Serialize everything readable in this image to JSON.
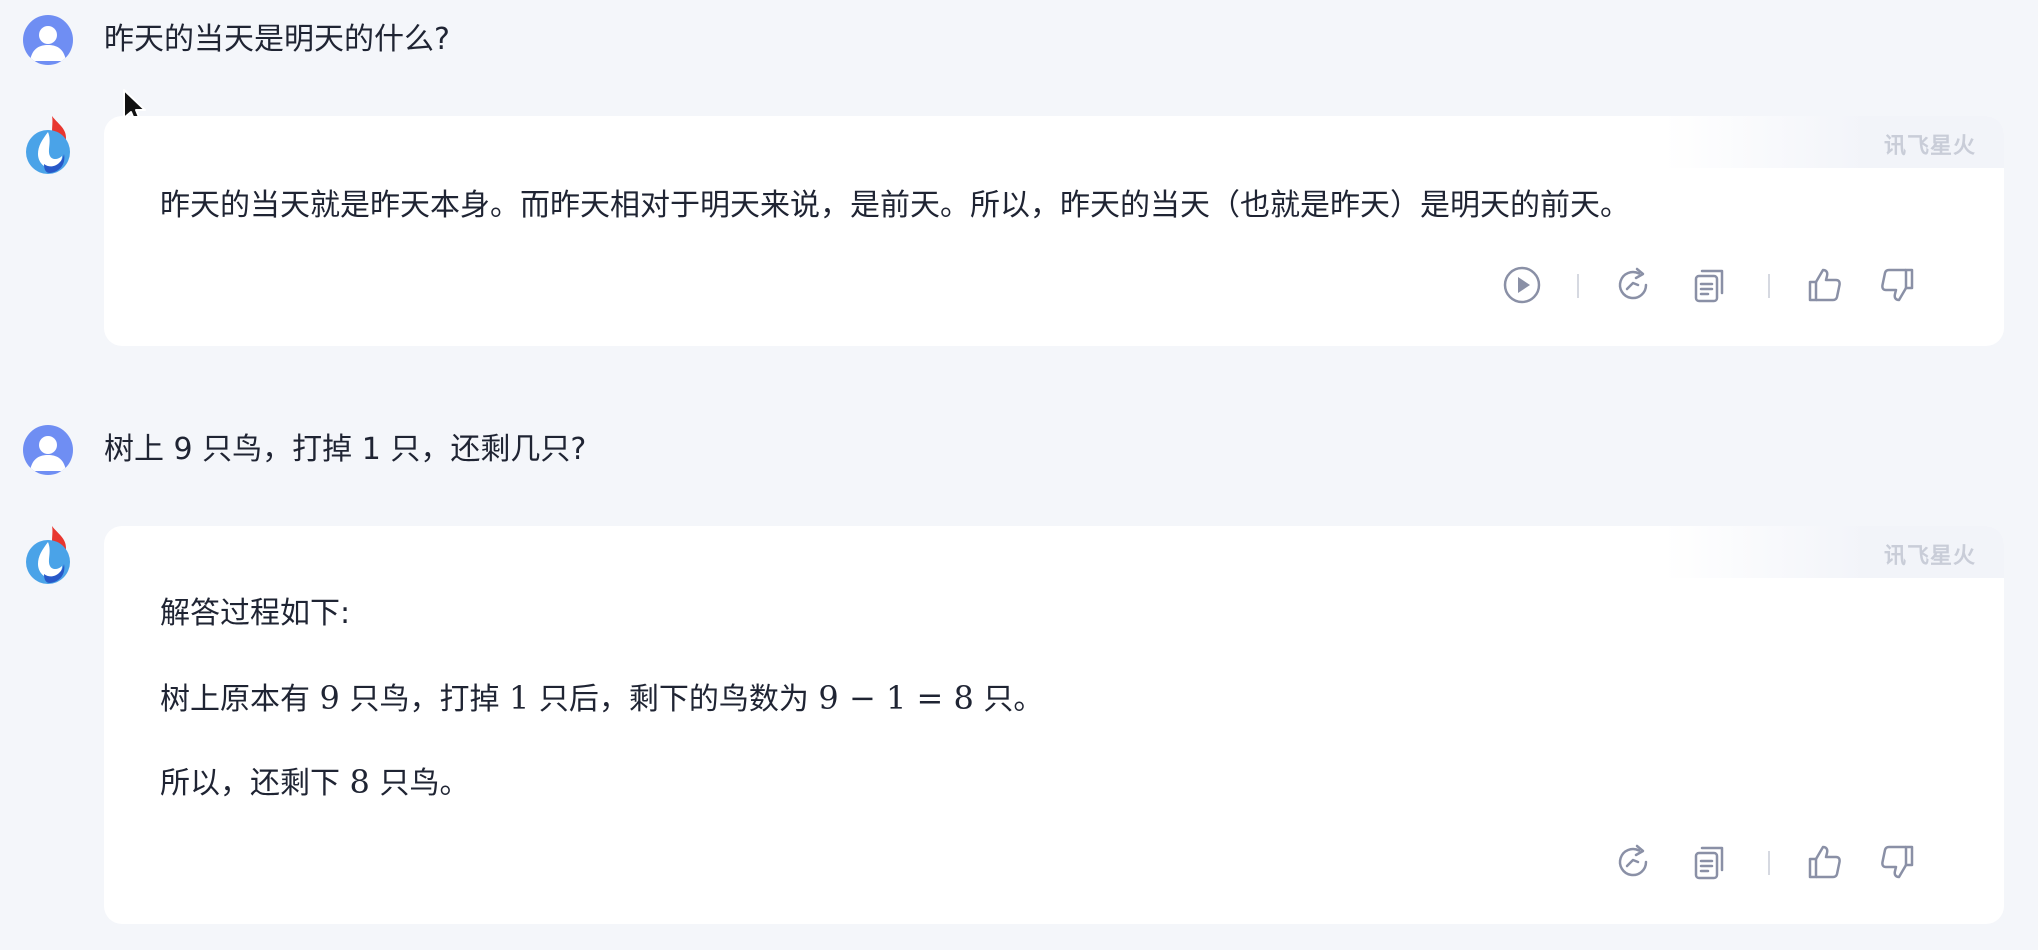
{
  "conversation": {
    "q1": "昨天的当天是明天的什么?",
    "a1": {
      "watermark": "讯飞星火",
      "text": "昨天的当天就是昨天本身。而昨天相对于明天来说，是前天。所以，昨天的当天（也就是昨天）是明天的前天。"
    },
    "q2": "树上 9 只鸟，打掉 1 只，还剩几只?",
    "a2": {
      "watermark": "讯飞星火",
      "line1": "解答过程如下:",
      "line2_pre": "树上原本有 ",
      "line2_n1": "9",
      "line2_mid1": " 只鸟，打掉 ",
      "line2_n2": "1",
      "line2_mid2": " 只后，剩下的鸟数为 ",
      "line2_expr": "9 − 1 = 8",
      "line2_post": " 只。",
      "line3_pre": "所以，还剩下 ",
      "line3_n": "8",
      "line3_post": " 只鸟。"
    }
  },
  "icons": {
    "play": "play-circle-icon",
    "regenerate": "refresh-icon",
    "copy": "copy-icon",
    "like": "thumbs-up-icon",
    "dislike": "thumbs-down-icon"
  },
  "colors": {
    "background": "#f4f6fa",
    "card": "#ffffff",
    "user_avatar": "#6f8ef3",
    "icon": "#8a90a6"
  }
}
